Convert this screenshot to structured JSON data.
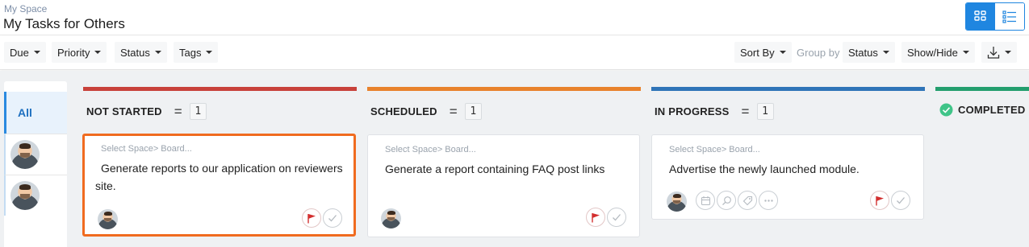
{
  "header": {
    "breadcrumb": "My Space",
    "title": "My Tasks for Others",
    "view_toggle": [
      "board-view-icon",
      "list-view-icon"
    ]
  },
  "toolbar": {
    "filters": [
      "Due",
      "Priority",
      "Status",
      "Tags"
    ],
    "sort_by": "Sort By",
    "group_by_label": "Group by",
    "group_by_value": "Status",
    "show_hide": "Show/Hide",
    "download_icon": "download-icon"
  },
  "sidebar": {
    "all_label": "All",
    "users": [
      "avatar",
      "avatar"
    ]
  },
  "colors": {
    "not_started": "#c8413a",
    "scheduled": "#e8822c",
    "in_progress": "#2f74b8",
    "completed": "#239e6e",
    "selected_border": "#f06b1f",
    "accent": "#1f86e0"
  },
  "columns": [
    {
      "name": "NOT STARTED",
      "count": "1",
      "card": {
        "crumb": "Select Space> Board...",
        "title": "Generate reports to our application on reviewers site."
      }
    },
    {
      "name": "SCHEDULED",
      "count": "1",
      "card": {
        "crumb": "Select Space> Board...",
        "title": "Generate a report containing FAQ post links"
      }
    },
    {
      "name": "IN PROGRESS",
      "count": "1",
      "card": {
        "crumb": "Select Space> Board...",
        "title": "Advertise the newly launched module."
      }
    },
    {
      "name": "COMPLETED"
    }
  ]
}
